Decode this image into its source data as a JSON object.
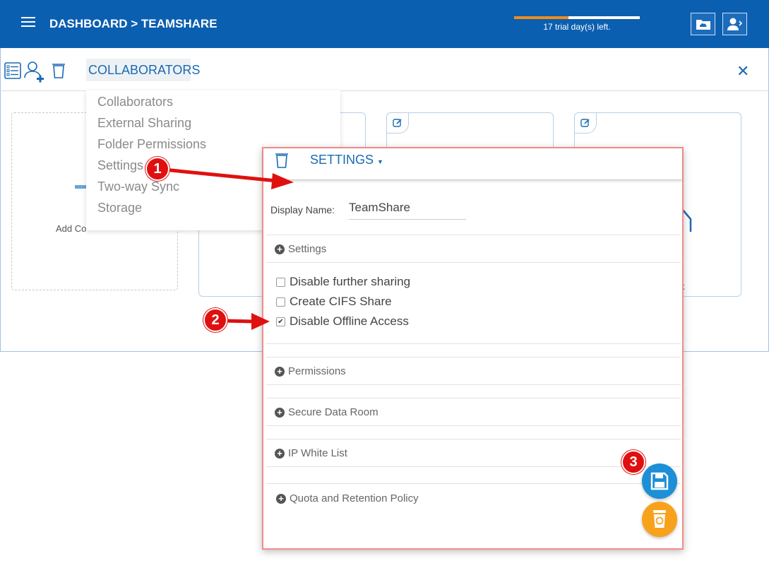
{
  "header": {
    "breadcrumb": "DASHBOARD > TEAMSHARE",
    "trial_text": "17 trial day(s) left.",
    "trial_progress": 0.43,
    "colors": {
      "bar": "#0b5fb0",
      "trial_fill": "#f08c1a"
    }
  },
  "toolbar": {
    "collaborators_label": "COLLABORATORS",
    "icons": [
      "list-icon",
      "add-user-icon",
      "trash-icon"
    ],
    "close_icon": "close-icon"
  },
  "dropdown": {
    "items": [
      "Collaborators",
      "External Sharing",
      "Folder Permissions",
      "Settings",
      "Two-way Sync",
      "Storage"
    ]
  },
  "add_card": {
    "label": "Add Co"
  },
  "panel": {
    "tab_label": "SETTINGS",
    "display_name_label": "Display Name:",
    "display_name_value": "TeamShare",
    "settings_section": "Settings",
    "checkboxes": [
      {
        "label": "Disable further sharing",
        "checked": false
      },
      {
        "label": "Create CIFS Share",
        "checked": false
      },
      {
        "label": "Disable Offline Access",
        "checked": true
      }
    ],
    "sections": [
      "Permissions",
      "Secure Data Room",
      "IP White List",
      "Quota and Retention Policy"
    ],
    "colors": {
      "save": "#1c8fd6",
      "recycle": "#f7a21b",
      "border": "#f28b8b"
    }
  },
  "annotations": [
    "1",
    "2",
    "3"
  ]
}
